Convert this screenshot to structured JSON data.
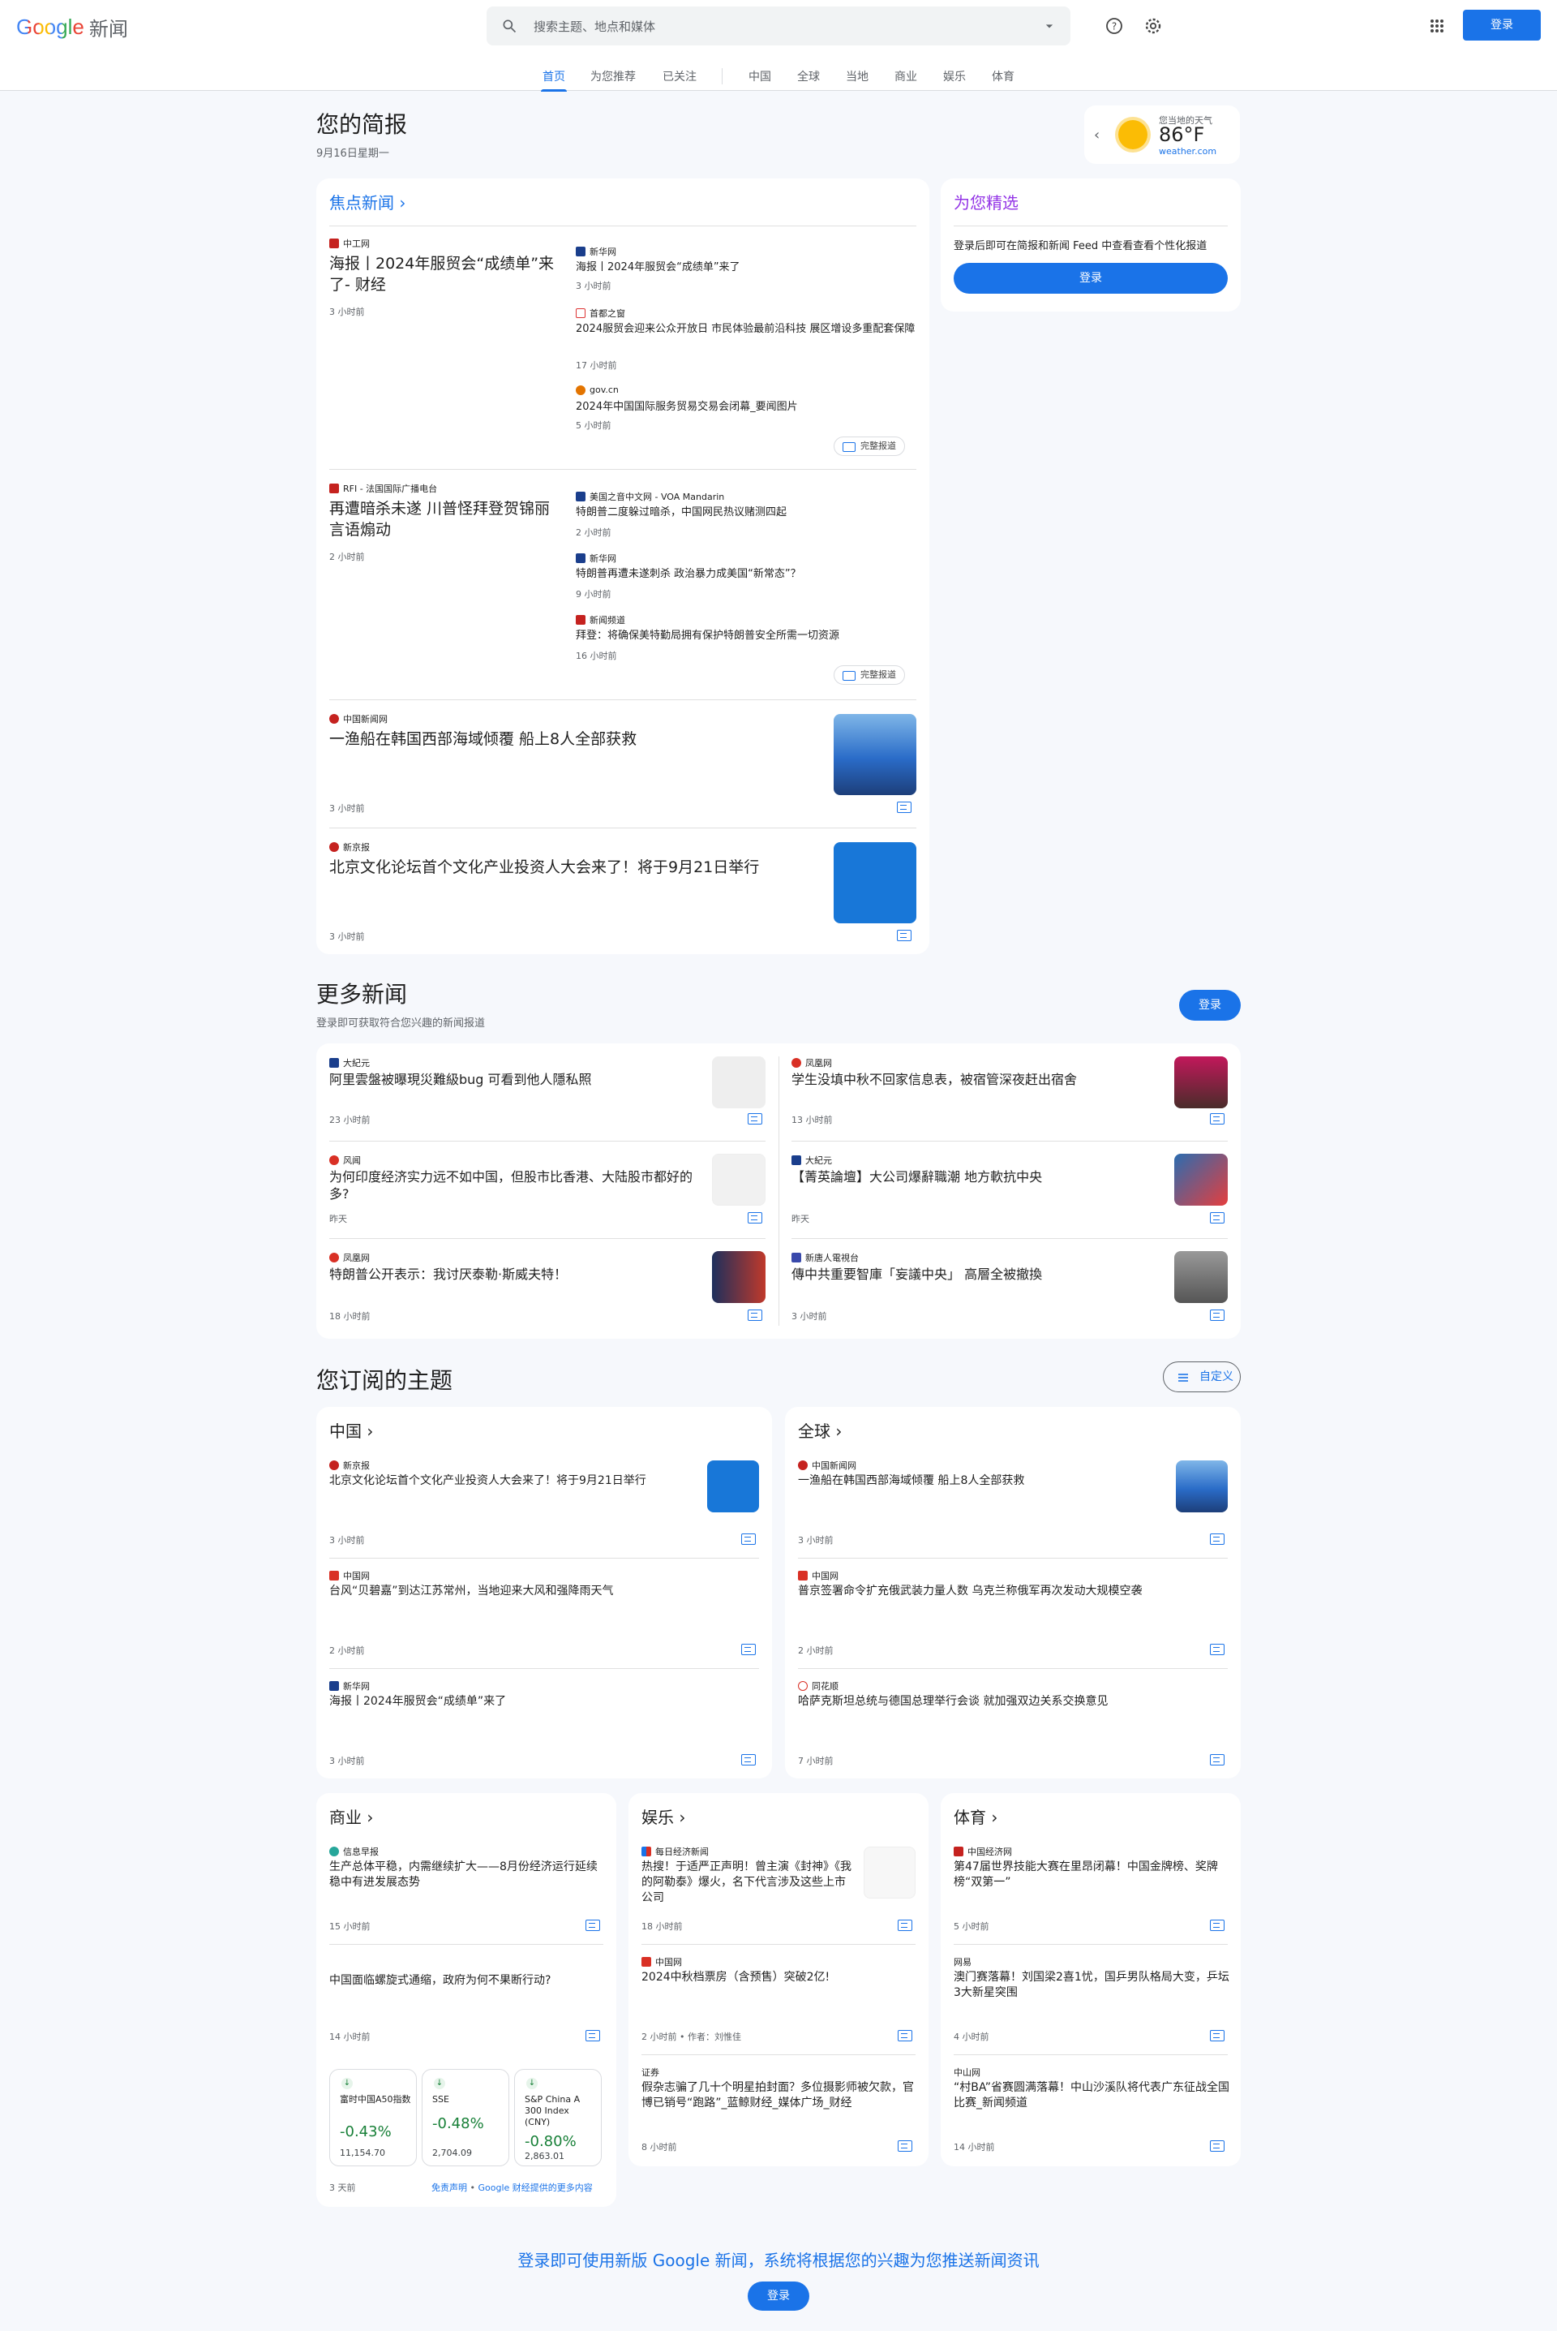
{
  "header": {
    "logo": "Google",
    "logo_suffix": "新闻",
    "search_placeholder": "搜索主题、地点和媒体",
    "signin": "登录"
  },
  "nav": [
    "首页",
    "为您推荐",
    "已关注",
    "中国",
    "全球",
    "当地",
    "商业",
    "娱乐",
    "体育"
  ],
  "brief": {
    "title": "您的简报",
    "date": "9月16日星期一"
  },
  "weather": {
    "location": "您当地的天气",
    "temp": "86°F",
    "source": "weather.com"
  },
  "top": {
    "label": "焦点新闻",
    "s1": {
      "src": "中工网",
      "title": "海报丨2024年服贸会“成绩单”来了- 财经",
      "time": "3 小时前",
      "rel": [
        {
          "src": "新华网",
          "title": "海报丨2024年服贸会“成绩单”来了",
          "time": "3 小时前"
        },
        {
          "src": "首都之窗",
          "title": "2024服贸会迎来公众开放日 市民体验最前沿科技 展区增设多重配套保障",
          "time": "17 小时前"
        },
        {
          "src": "gov.cn",
          "title": "2024年中国国际服务贸易交易会闭幕_要闻图片",
          "time": "5 小时前"
        }
      ]
    },
    "s2": {
      "src": "RFI - 法国国际广播电台",
      "title": "再遭暗杀未遂 川普怪拜登贺锦丽言语煽动",
      "time": "2 小时前",
      "rel": [
        {
          "src": "美国之音中文网 - VOA Mandarin",
          "title": "特朗普二度躲过暗杀，中国网民热议赌测四起",
          "time": "2 小时前"
        },
        {
          "src": "新华网",
          "title": "特朗普再遭未遂刺杀 政治暴力成美国“新常态”？",
          "time": "9 小时前"
        },
        {
          "src": "新闻频道",
          "title": "拜登：将确保美特勤局拥有保护特朗普安全所需一切资源",
          "time": "16 小时前"
        }
      ]
    },
    "full_coverage": "完整报道",
    "s3": {
      "src": "中国新闻网",
      "title": "一渔船在韩国西部海域倾覆 船上8人全部获救",
      "time": "3 小时前"
    },
    "s4": {
      "src": "新京报",
      "title": "北京文化论坛首个文化产业投资人大会来了！将于9月21日举行",
      "time": "3 小时前"
    }
  },
  "picks": {
    "title": "为您精选",
    "text": "登录后即可在简报和新闻 Feed 中查看查看个性化报道",
    "button": "登录"
  },
  "more": {
    "title": "更多新闻",
    "sub": "登录即可获取符合您兴趣的新闻报道",
    "button": "登录",
    "items": [
      {
        "src": "大紀元",
        "title": "阿里雲盤被曝現災難級bug 可看到他人隱私照",
        "time": "23 小时前"
      },
      {
        "src": "凤凰网",
        "title": "学生没填中秋不回家信息表，被宿管深夜赶出宿舍",
        "time": "13 小时前"
      },
      {
        "src": "风闻",
        "title": "为何印度经济实力远不如中国，但股市比香港、大陆股市都好的多?",
        "time": "昨天"
      },
      {
        "src": "大紀元",
        "title": "【菁英論壇】大公司爆辭職潮 地方軟抗中央",
        "time": "昨天"
      },
      {
        "src": "凤凰网",
        "title": "特朗普公开表示：我讨厌泰勒·斯威夫特！",
        "time": "18 小时前"
      },
      {
        "src": "新唐人電視台",
        "title": "傳中共重要智庫「妄議中央」 高層全被撤換",
        "time": "3 小时前"
      }
    ]
  },
  "topics": {
    "title": "您订阅的主题",
    "customize": "自定义",
    "china": {
      "label": "中国",
      "items": [
        {
          "src": "新京报",
          "title": "北京文化论坛首个文化产业投资人大会来了！将于9月21日举行",
          "time": "3 小时前"
        },
        {
          "src": "中国网",
          "title": "台风“贝碧嘉”到达江苏常州，当地迎来大风和强降雨天气",
          "time": "2 小时前"
        },
        {
          "src": "新华网",
          "title": "海报丨2024年服贸会“成绩单”来了",
          "time": "3 小时前"
        }
      ]
    },
    "world": {
      "label": "全球",
      "items": [
        {
          "src": "中国新闻网",
          "title": "一渔船在韩国西部海域倾覆 船上8人全部获救",
          "time": "3 小时前"
        },
        {
          "src": "中国网",
          "title": "普京签署命令扩充俄武装力量人数 乌克兰称俄军再次发动大规模空袭",
          "time": "2 小时前"
        },
        {
          "src": "同花顺",
          "title": "哈萨克斯坦总统与德国总理举行会谈 就加强双边关系交换意见",
          "time": "7 小时前"
        }
      ]
    },
    "biz": {
      "label": "商业",
      "items": [
        {
          "src": "信息早报",
          "title": "生产总体平稳，内需继续扩大——8月份经济运行延续稳中有进发展态势",
          "time": "15 小时前"
        },
        {
          "src": "",
          "title": "中国面临螺旋式通缩，政府为何不果断行动?",
          "time": "14 小时前"
        }
      ],
      "stocks": [
        {
          "name": "富时中国A50指数",
          "pct": "-0.43%",
          "val": "11,154.70"
        },
        {
          "name": "SSE",
          "pct": "-0.48%",
          "val": "2,704.09"
        },
        {
          "name": "S&P China A 300 Index (CNY)",
          "pct": "-0.80%",
          "val": "2,863.01"
        }
      ],
      "time": "3 天前",
      "disclaimer": "免责声明",
      "finance": "Google 财经提供的更多内容",
      "sep": " • "
    },
    "ent": {
      "label": "娱乐",
      "items": [
        {
          "src": "每日经济新闻",
          "title": "热搜！于适严正声明！曾主演《封神》《我的阿勒泰》爆火，名下代言涉及这些上市公司",
          "time": "18 小时前"
        },
        {
          "src": "中国网",
          "title": "2024中秋档票房（含预售）突破2亿!",
          "time": "2 小时前 • 作者：刘惟佳"
        },
        {
          "src": "证券",
          "title": "假杂志骗了几十个明星拍封面？多位摄影师被欠款，官博已销号“跑路”_蓝鲸财经_媒体广场_财经",
          "time": "8 小时前"
        }
      ]
    },
    "sports": {
      "label": "体育",
      "items": [
        {
          "src": "中国经济网",
          "title": "第47届世界技能大赛在里昂闭幕！中国金牌榜、奖牌榜“双第一”",
          "time": "5 小时前"
        },
        {
          "src": "网易",
          "title": "澳门赛落幕！刘国梁2喜1忧，国乒男队格局大变，乒坛3大新星突围",
          "time": "4 小时前"
        },
        {
          "src": "中山网",
          "title": "“村BA”省赛圆满落幕！中山沙溪队将代表广东征战全国比赛_新闻频道",
          "time": "14 小时前"
        }
      ]
    }
  },
  "footer": {
    "cta": "登录即可使用新版 Google 新闻，系统将根据您的兴趣为您推送新闻资讯",
    "button": "登录"
  }
}
